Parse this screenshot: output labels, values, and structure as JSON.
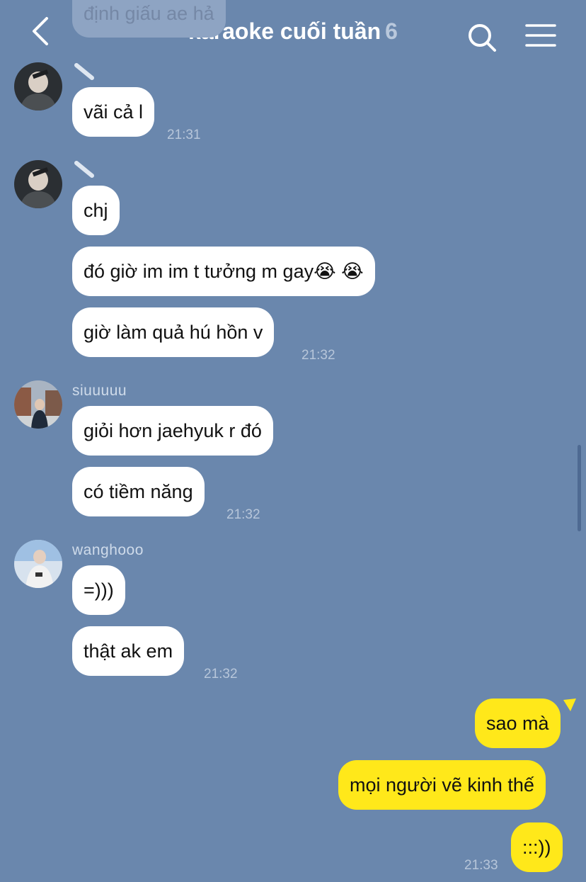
{
  "header": {
    "title": "karaoke cuối tuần",
    "member_count": "6",
    "back_icon": "chevron-left-icon",
    "search_icon": "search-icon",
    "menu_icon": "menu-icon"
  },
  "colors": {
    "background": "#6a87ad",
    "incoming_bubble": "#ffffff",
    "outgoing_bubble": "#ffe81a"
  },
  "messages": {
    "m0": "định giấu ae hả",
    "m1": "vãi cả l",
    "m2": "chj",
    "m3": "đó giờ im im t tưởng m gay",
    "m4": "giờ làm quả hú hồn v",
    "m5": "giỏi hơn jaehyuk r đó",
    "m6": "có tiềm năng",
    "m7": "=)))",
    "m8": "thật ak em",
    "o1": "sao mà",
    "o2": "mọi người vẽ kinh thế",
    "o3": ":::))"
  },
  "emoji": {
    "crying": "😭"
  },
  "senders": {
    "siu": "siuuuuu",
    "wang": "wanghooo"
  },
  "times": {
    "t1": "21:31",
    "t2": "21:32",
    "t3": "21:32",
    "t4": "21:32",
    "t5": "21:33"
  }
}
